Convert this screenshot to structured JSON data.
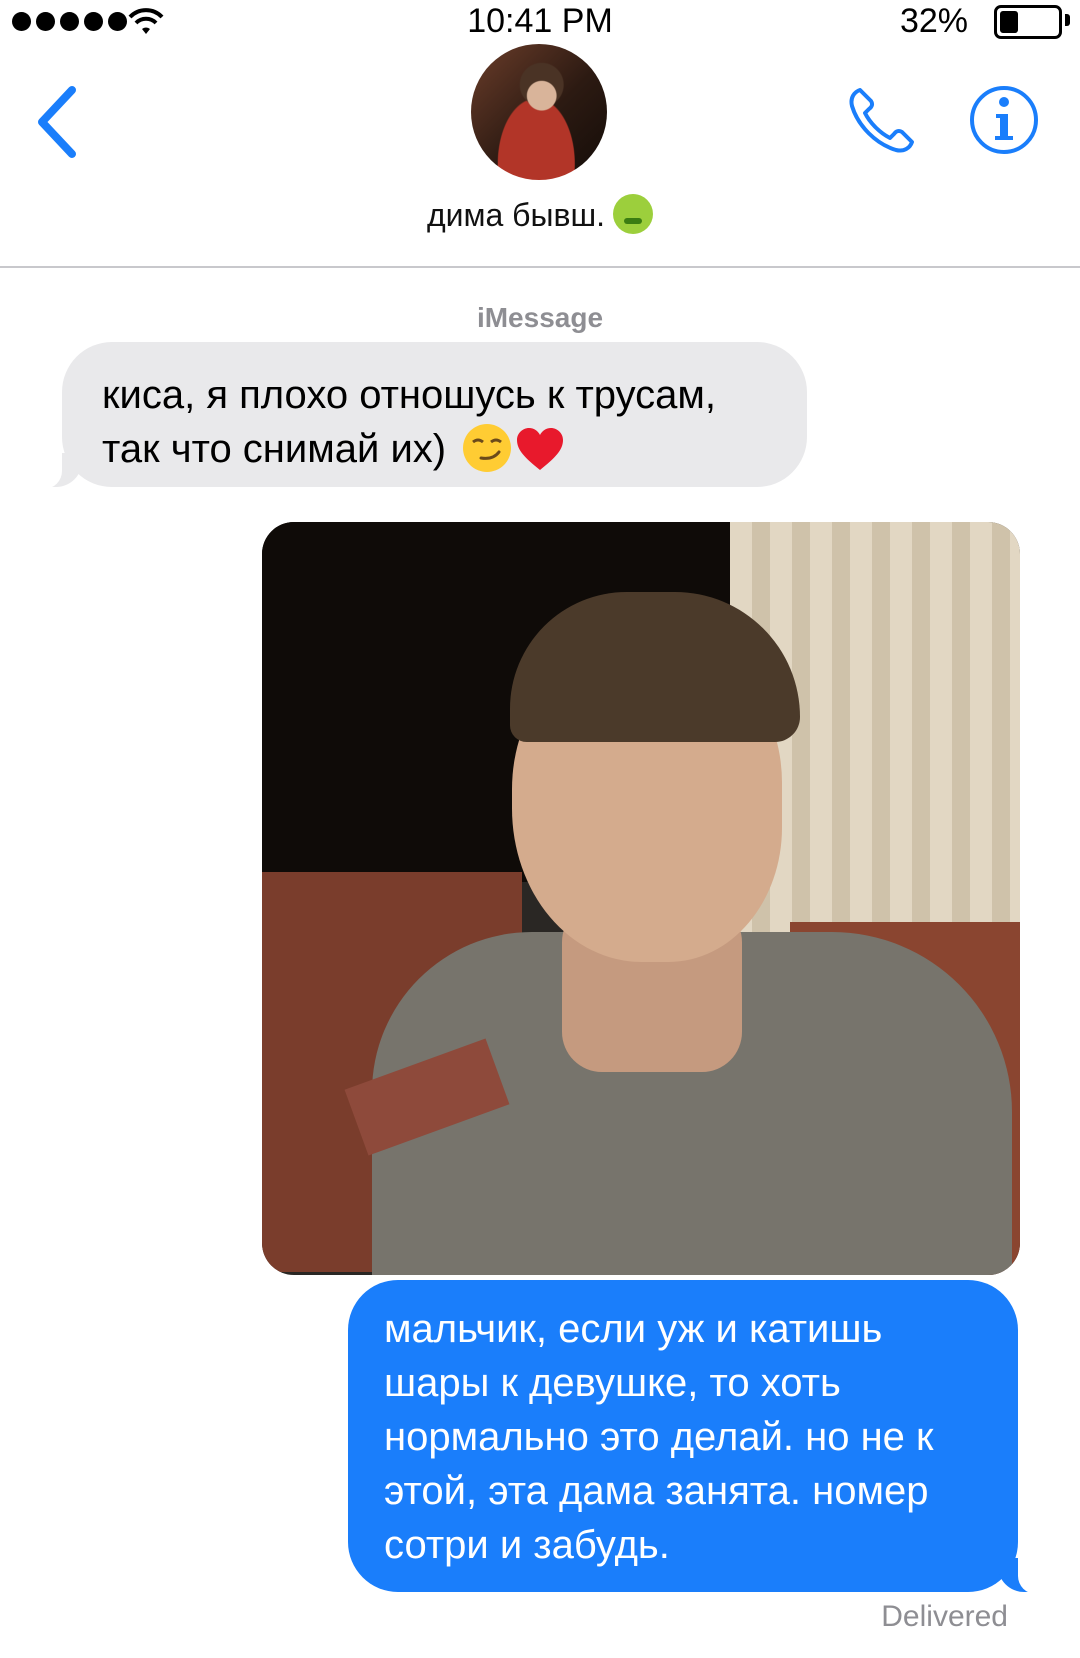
{
  "status_bar": {
    "time": "10:41 PM",
    "battery_percent": "32%",
    "battery_level": 0.32,
    "signal_bars": 5
  },
  "header": {
    "back_icon": "chevron-left-icon",
    "contact_name": "дима бывш.",
    "contact_emoji_icon": "nauseated-face-icon",
    "phone_icon": "phone-icon",
    "info_icon": "info-icon",
    "accent_color": "#1a7efb"
  },
  "conversation": {
    "service_label": "iMessage",
    "messages": [
      {
        "direction": "incoming",
        "lines": [
          "киса, я плохо отношусь к трусам,",
          "так что снимай их)"
        ],
        "emojis": [
          "smirking-face-icon",
          "red-heart-icon"
        ]
      },
      {
        "direction": "outgoing",
        "type": "photo",
        "image": "photo-of-man-in-tracksuit-jacket"
      },
      {
        "direction": "outgoing",
        "lines": [
          "мальчик, если уж и катишь",
          "шары к девушке, то хоть",
          "нормально это делай. но не к",
          "этой, эта дама занята. номер",
          "сотри и забудь."
        ]
      }
    ],
    "status": "Delivered",
    "incoming_bubble_color": "#e9e9eb",
    "outgoing_bubble_color": "#1a7efb"
  }
}
